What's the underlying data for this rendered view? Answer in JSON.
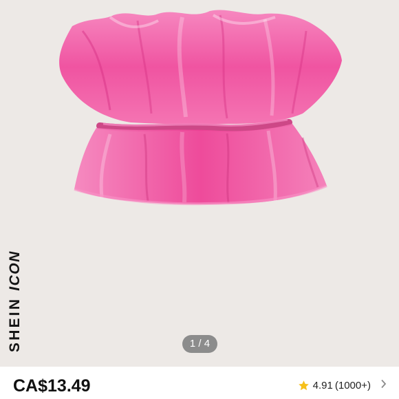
{
  "product": {
    "brand_line1": "SHEIN",
    "brand_line2": "ICON",
    "image_index": "1 / 4",
    "price": "CA$13.49",
    "rating": "4.91",
    "review_count": "(1000+)"
  },
  "icons": {
    "rating_star": "star-icon",
    "reviews_link": "chevron-right-icon"
  },
  "colors": {
    "background": "#ede9e6",
    "garment_pink": "#f25ba4",
    "star": "#f6c01a",
    "pager_bg": "#8c8c8c"
  }
}
